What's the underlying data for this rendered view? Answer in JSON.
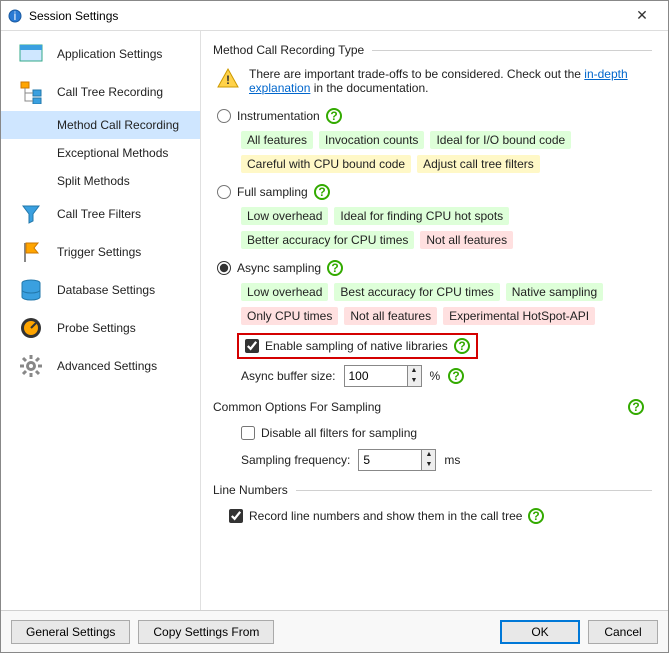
{
  "window": {
    "title": "Session Settings"
  },
  "sidebar": {
    "items": [
      {
        "label": "Application Settings"
      },
      {
        "label": "Call Tree Recording"
      },
      {
        "label": "Method Call Recording"
      },
      {
        "label": "Exceptional Methods"
      },
      {
        "label": "Split Methods"
      },
      {
        "label": "Call Tree Filters"
      },
      {
        "label": "Trigger Settings"
      },
      {
        "label": "Database Settings"
      },
      {
        "label": "Probe Settings"
      },
      {
        "label": "Advanced Settings"
      }
    ]
  },
  "section1": {
    "legend": "Method Call Recording Type",
    "warning_pre": "There are important trade-offs to be considered. Check out the ",
    "warning_link": "in-depth explanation",
    "warning_post": " in the documentation.",
    "r1": {
      "label": "Instrumentation",
      "tags": [
        "All features",
        "Invocation counts",
        "Ideal for I/O bound code",
        "Careful with CPU bound code",
        "Adjust call tree filters"
      ],
      "tag_colors": [
        "green",
        "green",
        "green",
        "yellow",
        "yellow"
      ]
    },
    "r2": {
      "label": "Full sampling",
      "tags": [
        "Low overhead",
        "Ideal for finding CPU hot spots",
        "Better accuracy for CPU times",
        "Not all features"
      ],
      "tag_colors": [
        "green",
        "green",
        "green",
        "red"
      ]
    },
    "r3": {
      "label": "Async sampling",
      "tags": [
        "Low overhead",
        "Best accuracy for CPU times",
        "Native sampling",
        "Only CPU times",
        "Not all features",
        "Experimental HotSpot-API"
      ],
      "tag_colors": [
        "green",
        "green",
        "green",
        "red",
        "red",
        "red"
      ]
    },
    "native_cb": "Enable sampling of native libraries",
    "buf_label": "Async buffer size:",
    "buf_value": "100",
    "buf_unit": "%"
  },
  "section2": {
    "legend": "Common Options For Sampling",
    "cb": "Disable all filters for sampling",
    "freq_label": "Sampling frequency:",
    "freq_value": "5",
    "freq_unit": "ms"
  },
  "section3": {
    "legend": "Line Numbers",
    "cb": "Record line numbers and show them in the call tree"
  },
  "footer": {
    "b1": "General Settings",
    "b2": "Copy Settings From",
    "ok": "OK",
    "cancel": "Cancel"
  }
}
